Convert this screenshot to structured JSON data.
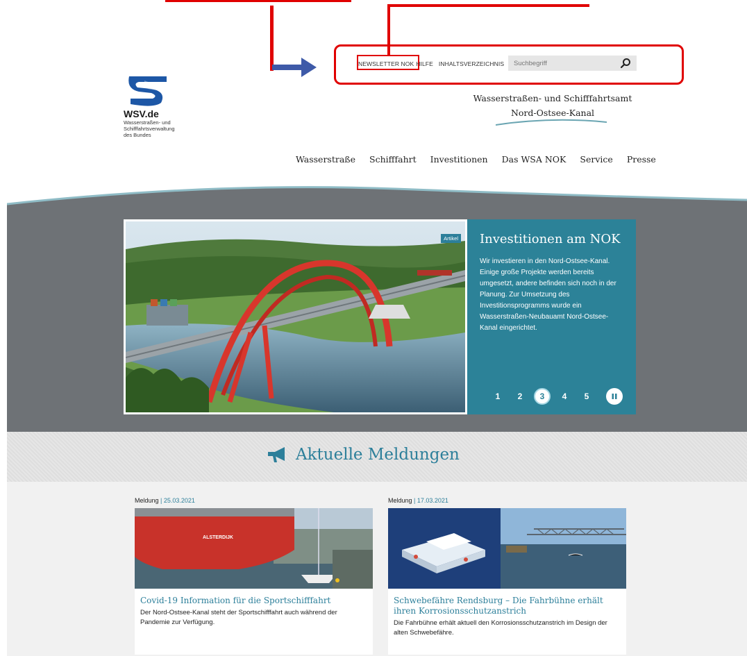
{
  "utility_nav": {
    "items": [
      {
        "label": "NEWSLETTER NOK"
      },
      {
        "label": "HILFE"
      },
      {
        "label": "INHALTSVERZEICHNIS"
      }
    ],
    "search_placeholder": "Suchbegriff"
  },
  "logo": {
    "title": "WSV.de",
    "subtitle_lines": [
      "Wasserstraßen- und",
      "Schifffahrtsverwaltung",
      "des Bundes"
    ]
  },
  "agency": {
    "line1": "Wasserstraßen- und Schifffahrtsamt",
    "line2": "Nord-Ostsee-Kanal"
  },
  "main_nav": {
    "items": [
      {
        "label": "Wasserstraße"
      },
      {
        "label": "Schifffahrt"
      },
      {
        "label": "Investitionen"
      },
      {
        "label": "Das WSA NOK"
      },
      {
        "label": "Service"
      },
      {
        "label": "Presse"
      }
    ]
  },
  "hero": {
    "tag": "Artikel",
    "title": "Investitionen am NOK",
    "text": "Wir investieren in den Nord-Ostsee-Kanal. Einige große Projekte werden bereits umgesetzt, andere befinden sich noch in der Planung. Zur Umsetzung des Investitionsprogramms wurde ein Wasserstraßen-Neubauamt Nord-Ostsee-Kanal eingerichtet.",
    "pages": [
      "1",
      "2",
      "3",
      "4",
      "5"
    ],
    "active_page": 3
  },
  "news": {
    "heading": "Aktuelle Meldungen",
    "cards": [
      {
        "type": "Meldung",
        "date": "25.03.2021",
        "title": "Covid-19 Information für die Sportschifffahrt",
        "desc": "Der Nord-Ostsee-Kanal steht der Sportschifffahrt auch während der Pandemie zur Verfügung.",
        "ship_name": "ALSTERDIJK"
      },
      {
        "type": "Meldung",
        "date": "17.03.2021",
        "title": "Schwebefähre Rendsburg – Die Fahrbühne erhält ihren Korrosionsschutzanstrich",
        "desc": "Die Fahrbühne erhält aktuell den Korrosionsschutzanstrich im Design der alten Schwebefähre."
      }
    ]
  },
  "colors": {
    "accent": "#2c7f9a",
    "annotation": "#e00000",
    "arrow": "#3e5aa8",
    "hero_band": "#6e7276"
  }
}
